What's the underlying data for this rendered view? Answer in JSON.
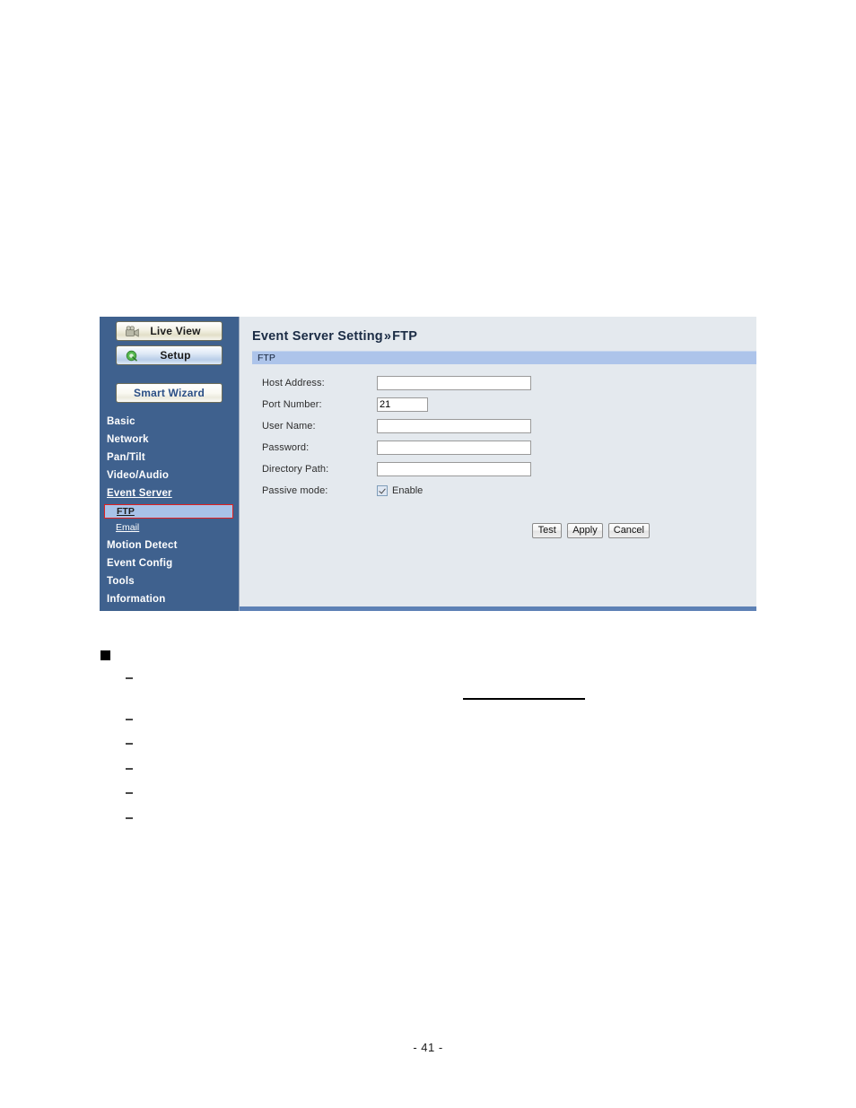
{
  "document": {
    "page_number": "- 41 -"
  },
  "device_ui": {
    "sidebar": {
      "buttons": [
        {
          "label": "Live View",
          "icon": "video-camera-icon"
        },
        {
          "label": "Setup",
          "icon": "setup-gear-icon"
        },
        {
          "label": "Smart Wizard",
          "icon": "none"
        }
      ],
      "items": [
        {
          "label": "Basic"
        },
        {
          "label": "Network"
        },
        {
          "label": "Pan/Tilt"
        },
        {
          "label": "Video/Audio"
        },
        {
          "label": "Event Server"
        },
        {
          "label": "Motion Detect"
        },
        {
          "label": "Event Config"
        },
        {
          "label": "Tools"
        },
        {
          "label": "Information"
        }
      ],
      "subitems": [
        {
          "label": "FTP",
          "selected": true
        },
        {
          "label": "Email",
          "selected": false
        }
      ],
      "colors": {
        "background": "#3f618e",
        "selected_background": "#a8c2e8",
        "selection_outline": "#e02020",
        "text": "#ffffff"
      }
    },
    "content": {
      "title_main": "Event Server Setting",
      "title_separator": "»",
      "title_sub": "FTP",
      "section_bar_label": "FTP",
      "fields": [
        {
          "label": "Host Address:",
          "value": "",
          "placeholder": "",
          "size": "wide",
          "name": "host-address"
        },
        {
          "label": "Port Number:",
          "value": "21",
          "placeholder": "",
          "size": "small",
          "name": "port-number"
        },
        {
          "label": "User Name:",
          "value": "",
          "placeholder": "",
          "size": "wide",
          "name": "user-name"
        },
        {
          "label": "Password:",
          "value": "",
          "placeholder": "",
          "size": "wide",
          "name": "password"
        },
        {
          "label": "Directory Path:",
          "value": "",
          "placeholder": "",
          "size": "wide",
          "name": "directory-path"
        }
      ],
      "passive_mode": {
        "label": "Passive mode:",
        "checkbox_label": "Enable",
        "checked": true
      },
      "buttons": [
        {
          "label": "Test",
          "name": "test-button"
        },
        {
          "label": "Apply",
          "name": "apply-button"
        },
        {
          "label": "Cancel",
          "name": "cancel-button"
        }
      ],
      "colors": {
        "panel_background": "#e4e9ee",
        "section_bar": "#adc4ea",
        "bottom_bar": "#5d81b5",
        "title_text": "#1b2c45"
      }
    }
  }
}
